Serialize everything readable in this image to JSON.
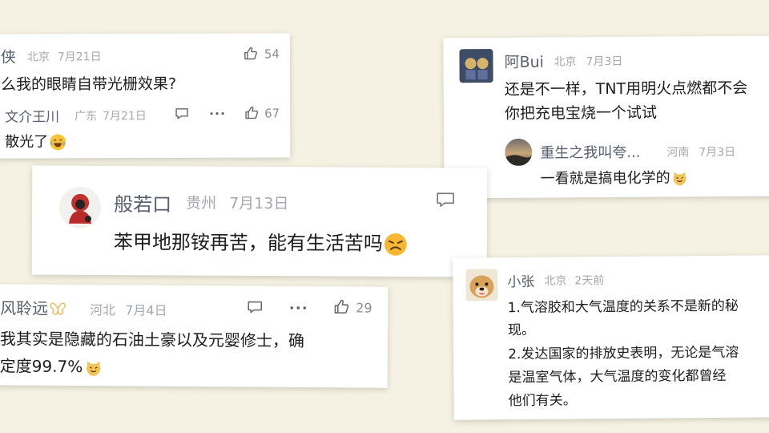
{
  "background_color": "#f6f2e3",
  "cards": {
    "card1": {
      "comment": {
        "author": "大侠",
        "location": "北京",
        "date": "7月21日",
        "likes": "54",
        "text": "什么我的眼睛自带光栅效果?"
      },
      "reply": {
        "author": "文介王川",
        "location": "广东",
        "date": "7月21日",
        "likes": "67",
        "text": "散光了"
      }
    },
    "card2": {
      "comment": {
        "author": "阿Bui",
        "location": "北京",
        "date": "7月3日",
        "text_line1": "还是不一样，TNT用明火点燃都不会",
        "text_line2": "你把充电宝烧一个试试"
      },
      "reply": {
        "author": "重生之我叫夸...",
        "location": "河南",
        "date": "7月3日",
        "text": "一看就是搞电化学的"
      }
    },
    "card3": {
      "comment": {
        "author": "般若口",
        "location": "贵州",
        "date": "7月13日",
        "text": "苯甲地那铵再苦，能有生活苦吗"
      }
    },
    "card4": {
      "comment": {
        "author": "风聆远",
        "location": "河北",
        "date": "7月4日",
        "likes": "29",
        "text_line1": "我其实是隐藏的石油土豪以及元婴修士，确",
        "text_line2": "定度99.7%"
      }
    },
    "card5": {
      "comment": {
        "author": "小张",
        "location": "北京",
        "date": "2天前",
        "lines": [
          "1.气溶胶和大气温度的关系不是新的秘",
          "现。",
          "2.发达国家的排放史表明，无论是气溶",
          "是温室气体，大气温度的变化都曾经",
          "他们有关。"
        ]
      }
    }
  }
}
